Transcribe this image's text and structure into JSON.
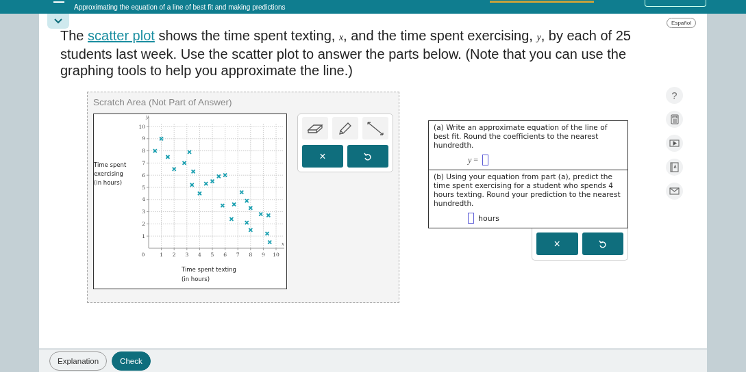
{
  "top_bar": {
    "title": "Approximating the equation of a line of best fit and making predictions",
    "progress": {
      "level": 1
    }
  },
  "language_button": "Español",
  "prompt": {
    "before": "The ",
    "link": "scatter plot",
    "after": " shows the time spent texting, *x*, and the time spent exercising, *y*, by each of 25 students last week. Use the scatter plot to answer the parts below. (Note that you can use the graphing tools to help you approximate the line.)"
  },
  "scratch_area": {
    "title": "Scratch Area (Not Part of Answer)",
    "graph": {
      "x_symbol": "x",
      "y_symbol": "y",
      "origin_label": "0",
      "chart_data": {
        "type": "scatter",
        "grid": true,
        "xlabel": "Time spent texting (in hours)",
        "ylabel": "Time spent exercising (in hours)",
        "xlim": [
          0,
          10
        ],
        "ylim": [
          0,
          10
        ],
        "xticks": [
          1,
          2,
          3,
          4,
          5,
          6,
          7,
          8,
          9,
          10
        ],
        "yticks": [
          1,
          2,
          3,
          4,
          5,
          6,
          7,
          8,
          9,
          10
        ],
        "series": [
          {
            "color": "#1a9fb0",
            "x": [
              0.5,
              1,
              1.5,
              2,
              2.8,
              3.2,
              3.5,
              3.4,
              4,
              4.5,
              5,
              5.5,
              6,
              5.8,
              6.7,
              6.5,
              7.3,
              7.7,
              8,
              7.7,
              8,
              8.8,
              9.4,
              9.3,
              9.5
            ],
            "values": [
              8,
              9,
              7.5,
              6.5,
              7,
              7.9,
              6.3,
              5.2,
              4.5,
              5.3,
              5.5,
              5.9,
              6,
              3.5,
              3.6,
              2.4,
              4.6,
              3.9,
              3.3,
              2.1,
              1.5,
              2.8,
              2.7,
              1.2,
              0.5
            ]
          }
        ]
      }
    },
    "tools": [
      {
        "kind": "eraser"
      },
      {
        "kind": "pencil"
      },
      {
        "kind": "line"
      }
    ],
    "tool_actions": [
      {
        "kind": "clear",
        "label": "×"
      },
      {
        "kind": "undo"
      }
    ]
  },
  "answer": {
    "parts": [
      {
        "question": "(a) Write an approximate equation of the line of best fit. Round the coefficients to the nearest hundredth.",
        "prefix": "*y* ="
      },
      {
        "question": "(b) Using your equation from part (a), predict the time spent exercising for a student who spends 4 hours texting. Round your prediction to the nearest hundredth.",
        "suffix": "hours"
      }
    ],
    "actions": [
      {
        "kind": "clear",
        "label": "×"
      },
      {
        "kind": "undo"
      }
    ]
  },
  "side_tools": [
    {
      "kind": "help",
      "label": "?"
    },
    {
      "kind": "calculator"
    },
    {
      "kind": "video"
    },
    {
      "kind": "glossary"
    },
    {
      "kind": "mail"
    }
  ],
  "footer": {
    "buttons": [
      {
        "label": "Explanation",
        "primary": false
      },
      {
        "label": "Check",
        "primary": true
      }
    ]
  }
}
